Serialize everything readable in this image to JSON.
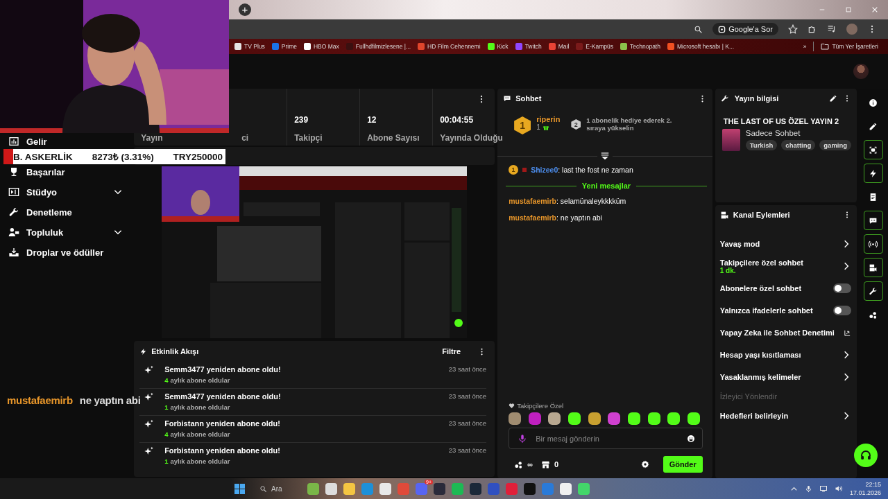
{
  "browser": {
    "new_tab": "+",
    "ask_chip": "Google'a Sor",
    "bookmarks": [
      {
        "label": "TV Plus",
        "color": "#e4e4e4"
      },
      {
        "label": "Prime",
        "color": "#1a73e8"
      },
      {
        "label": "HBO Max",
        "color": "#ffffff"
      },
      {
        "label": "Fullhdfilmizlesene |...",
        "color": "#3a1010"
      },
      {
        "label": "HD Film Cehennemi",
        "color": "#e0452c"
      },
      {
        "label": "Kick",
        "color": "#53fc18"
      },
      {
        "label": "Twitch",
        "color": "#9146ff"
      },
      {
        "label": "Mail",
        "color": "#ea4335"
      },
      {
        "label": "E-Kampüs",
        "color": "#7a1a1a"
      },
      {
        "label": "Technopath",
        "color": "#8bc34a"
      },
      {
        "label": "Microsoft hesabı | K...",
        "color": "#f25022"
      }
    ],
    "overflow": "»",
    "all_bookmarks": "Tüm Yer İşaretleri"
  },
  "ticker": {
    "name": "B. ASKERLİK",
    "amount": "8273₺ (3.31%)",
    "goal": "TRY250000"
  },
  "overlay_chat": {
    "user": "mustafaemirb",
    "message": "ne yaptın abi"
  },
  "sidebar": {
    "items": [
      {
        "kind": "revenue",
        "label": "Gelir",
        "expandable": false
      },
      {
        "kind": "trophy",
        "label": "Başarılar",
        "expandable": false
      },
      {
        "kind": "studio",
        "label": "Stüdyo",
        "expandable": true
      },
      {
        "kind": "moderation",
        "label": "Denetleme",
        "expandable": false
      },
      {
        "kind": "community",
        "label": "Topluluk",
        "expandable": true
      },
      {
        "kind": "drops",
        "label": "Droplar ve ödüller",
        "expandable": false
      }
    ]
  },
  "stats": [
    {
      "label": "Yayın"
    },
    {
      "label": "ci"
    },
    {
      "value": "239",
      "label": "Takipçi"
    },
    {
      "value": "12",
      "label": "Abone Sayısı"
    },
    {
      "value": "00:04:55",
      "label": "Yayında Olduğu"
    }
  ],
  "activity": {
    "title": "Etkinlik Akışı",
    "filter": "Filtre",
    "events": [
      {
        "title": "Semm3477 yeniden abone oldu!",
        "months": "4",
        "detail": "aylık abone oldular",
        "time": "23 saat önce"
      },
      {
        "title": "Semm3477 yeniden abone oldu!",
        "months": "1",
        "detail": "aylık abone oldular",
        "time": "23 saat önce"
      },
      {
        "title": "Forbistann yeniden abone oldu!",
        "months": "4",
        "detail": "aylık abone oldular",
        "time": "23 saat önce"
      },
      {
        "title": "Forbistann yeniden abone oldu!",
        "months": "1",
        "detail": "aylık abone oldular",
        "time": "23 saat önce"
      }
    ]
  },
  "chat": {
    "title": "Sohbet",
    "leader": {
      "rank": "1",
      "name": "riperin",
      "gifts": "1",
      "next_rank": "2",
      "hint": "1 abonelik hediye ederek 2. sıraya yükselin"
    },
    "messages": [
      {
        "kind": "message",
        "badge": "1",
        "user": "Shizee0",
        "color": "#4d8ff0",
        "text": ": last the fost ne zaman"
      },
      {
        "kind": "divider",
        "text": "Yeni mesajlar"
      },
      {
        "kind": "message",
        "user": "mustafaemirb",
        "color": "#e8962a",
        "text": ": selamünaleykkkküm"
      },
      {
        "kind": "message",
        "user": "mustafaemirb",
        "color": "#e8962a",
        "text": ": ne yaptın abi"
      }
    ],
    "emote_label": "Takipçilere Özel",
    "emotes": [
      {
        "color": "#a08c70"
      },
      {
        "color": "#c020c0"
      },
      {
        "color": "#b8a890"
      },
      {
        "color": "#53fc18"
      },
      {
        "color": "#c8a030"
      },
      {
        "color": "#d040d0"
      },
      {
        "color": "#53fc18"
      },
      {
        "color": "#53fc18"
      },
      {
        "color": "#53fc18"
      },
      {
        "color": "#53fc18"
      }
    ],
    "placeholder": "Bir mesaj gönderin",
    "points": "∞",
    "store_count": "0",
    "send": "Gönder"
  },
  "stream_info": {
    "title": "Yayın bilgisi",
    "stream_title": "THE LAST OF US ÖZEL YAYIN 2",
    "category": "Sadece Sohbet",
    "tags": [
      "Turkish",
      "chatting",
      "gaming"
    ]
  },
  "channel_actions": {
    "title": "Kanal Eylemleri",
    "items": [
      {
        "kind": "link",
        "label": "Yavaş mod"
      },
      {
        "kind": "link",
        "label": "Takipçilere özel sohbet",
        "value": "1 dk."
      },
      {
        "kind": "toggle",
        "label": "Abonelere özel sohbet",
        "on": false
      },
      {
        "kind": "toggle",
        "label": "Yalnızca ifadelerle sohbet",
        "on": false
      },
      {
        "kind": "external",
        "label": "Yapay Zeka ile Sohbet Denetimi"
      },
      {
        "kind": "link",
        "label": "Hesap yaşı kısıtlaması"
      },
      {
        "kind": "link",
        "label": "Yasaklanmış kelimeler"
      },
      {
        "kind": "section",
        "label": "İzleyici Yönlendir"
      },
      {
        "kind": "link",
        "label": "Hedefleri belirleyin"
      }
    ]
  },
  "rail": [
    {
      "kind": "info",
      "outlined": false
    },
    {
      "kind": "pencil",
      "outlined": false
    },
    {
      "kind": "capture",
      "outlined": true
    },
    {
      "kind": "bolt",
      "outlined": true
    },
    {
      "kind": "document",
      "outlined": false
    },
    {
      "kind": "chat",
      "outlined": true
    },
    {
      "kind": "broadcast",
      "outlined": true
    },
    {
      "kind": "camera",
      "outlined": true
    },
    {
      "kind": "wrench",
      "outlined": true
    },
    {
      "kind": "dots",
      "outlined": false
    }
  ],
  "taskbar": {
    "search_placeholder": "Ara",
    "apps": [
      {
        "color": "#7ab648"
      },
      {
        "color": "#dddddd"
      },
      {
        "color": "#f4c542"
      },
      {
        "color": "#1e90d8"
      },
      {
        "color": "#e8e8e8"
      },
      {
        "color": "#e04a3a"
      },
      {
        "color": "#5865f2",
        "badge": "9+"
      },
      {
        "color": "#2a2a3a"
      },
      {
        "color": "#1db954"
      },
      {
        "color": "#1b2838"
      },
      {
        "color": "#3050c0"
      },
      {
        "color": "#e0203a"
      },
      {
        "color": "#111111"
      },
      {
        "color": "#2a7ad8"
      },
      {
        "color": "#f0f0f0"
      },
      {
        "color": "#43d66a"
      }
    ],
    "time": "22:15",
    "date": "17.01.2026"
  }
}
